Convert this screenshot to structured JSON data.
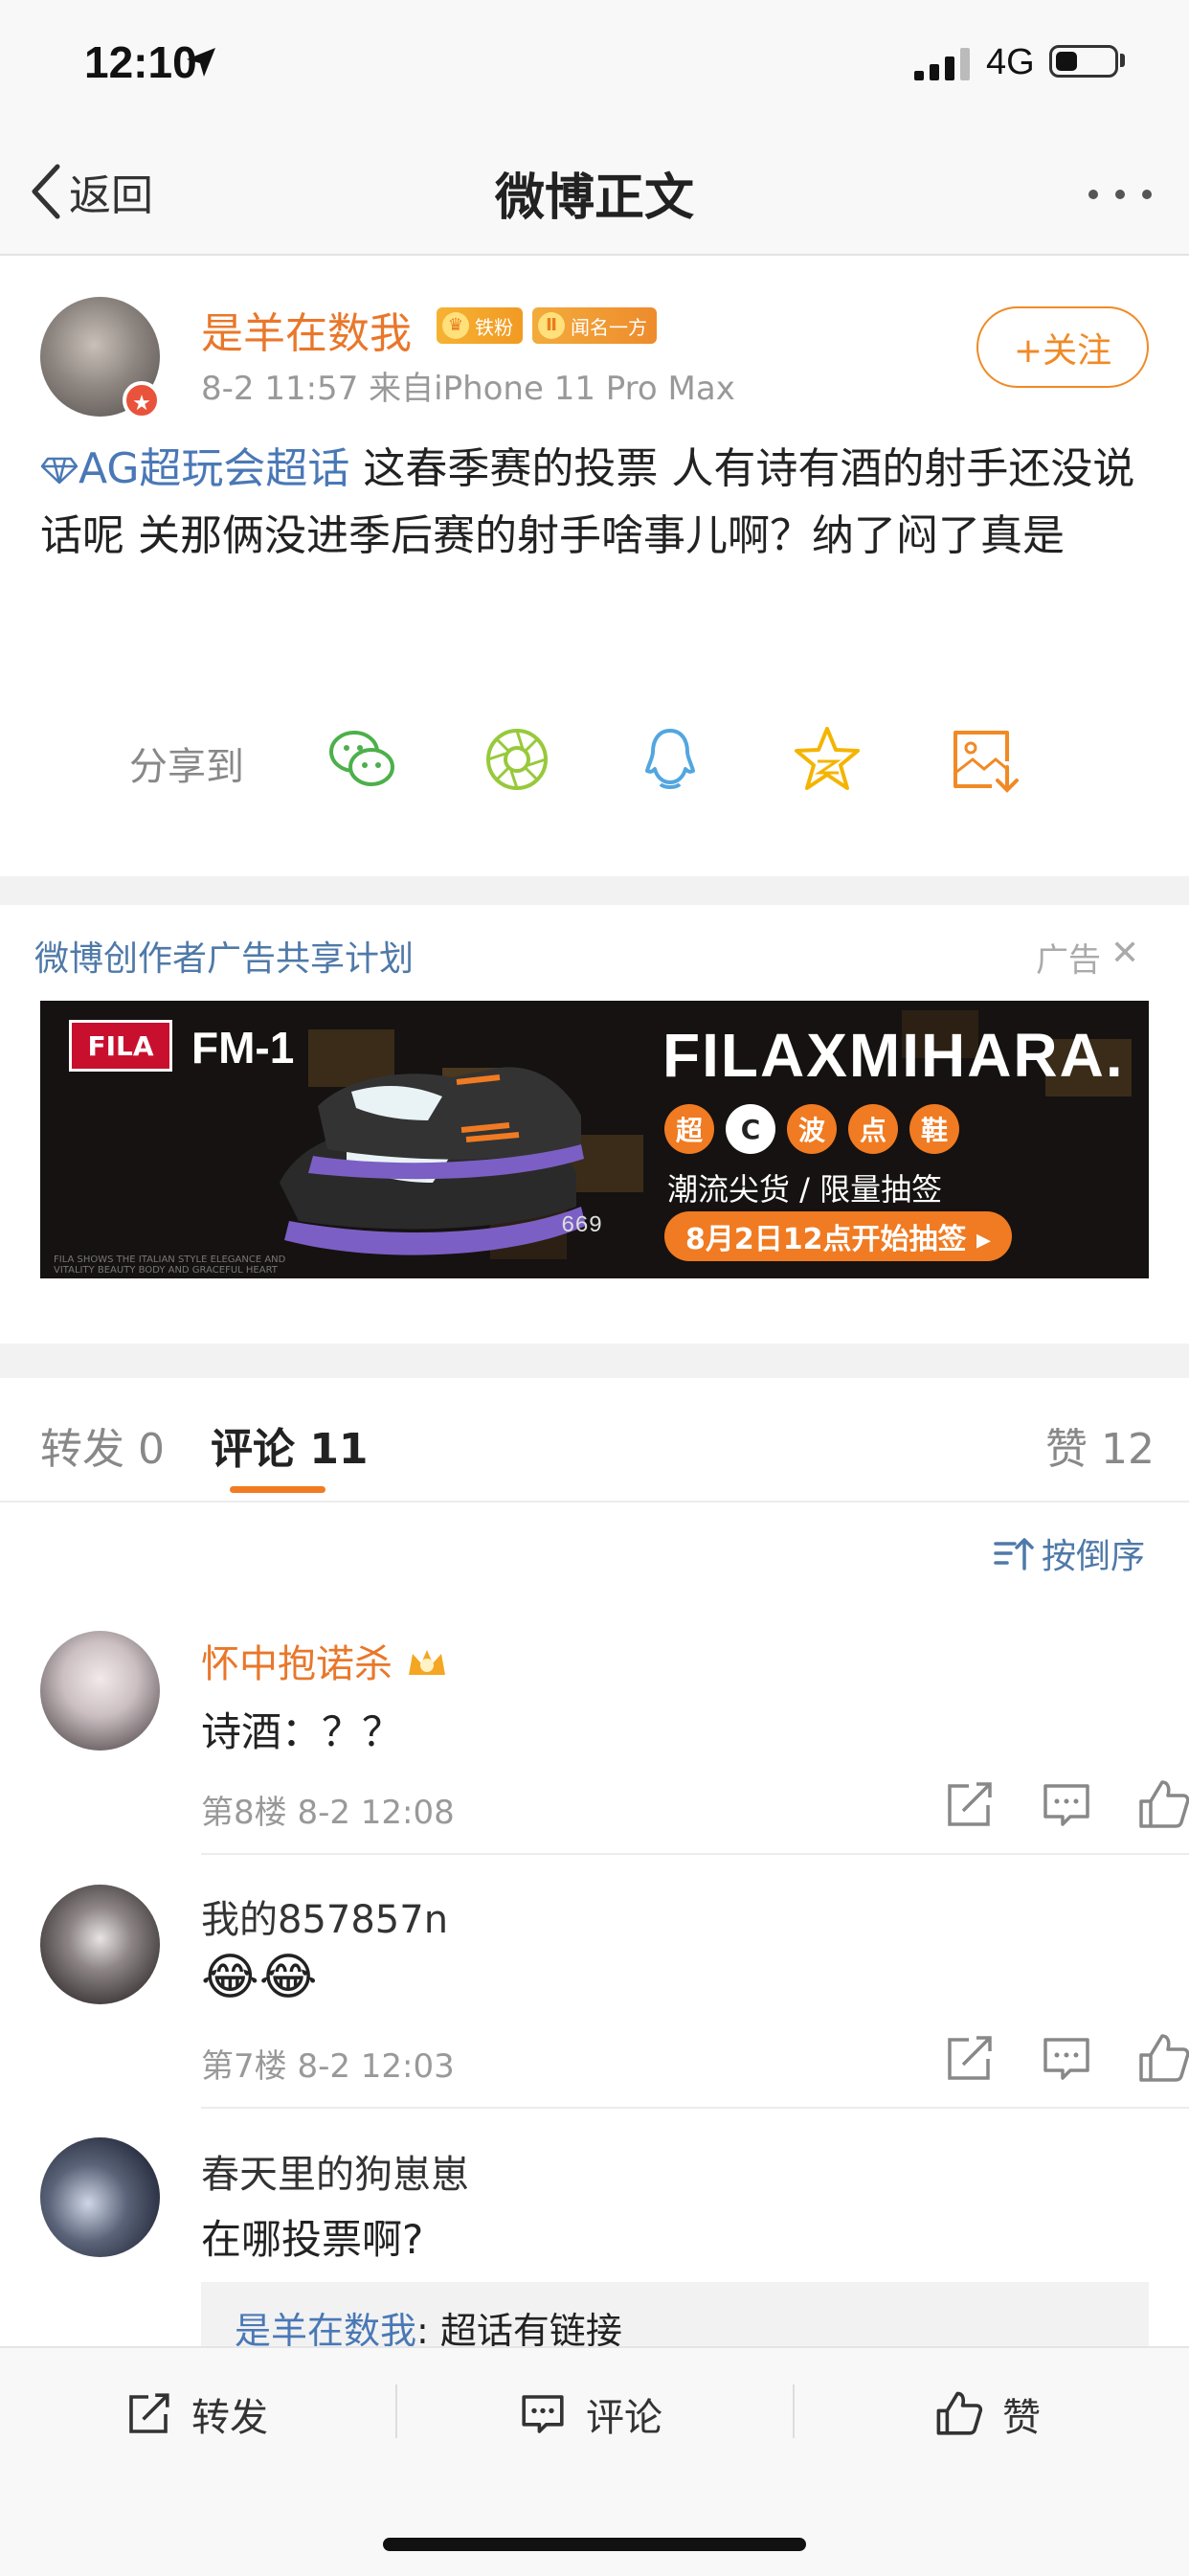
{
  "status_bar": {
    "time": "12:10",
    "network": "4G"
  },
  "nav": {
    "back_label": "返回",
    "title": "微博正文"
  },
  "post": {
    "author": "是羊在数我",
    "badge_fan": "铁粉",
    "badge_fame": "闻名一方",
    "meta": "8-2 11:57  来自iPhone 11 Pro Max",
    "follow_label": "+关注",
    "topic": "AG超玩会超话",
    "text": " 这春季赛的投票 人有诗有酒的射手还没说话呢 关那俩没进季后赛的射手啥事儿啊？纳了闷了真是"
  },
  "share": {
    "label": "分享到",
    "targets": [
      "wechat-icon",
      "moments-icon",
      "qq-icon",
      "qzone-icon",
      "save-image-icon"
    ]
  },
  "ad": {
    "title": "微博创作者广告共享计划",
    "label": "广告",
    "brand": "FILA",
    "model": "FM-1",
    "headline": "FILAXMIHARA.",
    "tags": [
      "超",
      "C",
      "波",
      "点",
      "鞋"
    ],
    "subtitle": "潮流尖货 / 限量抽签",
    "cta": "8月2日12点开始抽签 ▸",
    "price_tag": "669",
    "fine_print": "FILA SHOWS THE ITALIAN STYLE ELEGANCE AND VITALITY BEAUTY BODY AND GRACEFUL HEART"
  },
  "tabs": {
    "repost": "转发 0",
    "comments": "评论 11",
    "likes": "赞 12"
  },
  "sort_label": "按倒序",
  "comments": [
    {
      "name": "怀中抱诺杀",
      "text": "诗酒：？？",
      "meta": "第8楼 8-2 12:08"
    },
    {
      "name": "我的857857n",
      "text": "😂😂",
      "meta": "第7楼 8-2 12:03"
    },
    {
      "name": "春天里的狗崽崽",
      "text": "在哪投票啊?",
      "reply_author": "是羊在数我",
      "reply_text": ": 超话有链接"
    }
  ],
  "bottom_bar": {
    "repost": "转发",
    "comment": "评论",
    "like": "赞"
  },
  "colors": {
    "accent_orange": "#f07b22",
    "link_blue": "#4a78b6",
    "username_orange": "#e9772a"
  }
}
